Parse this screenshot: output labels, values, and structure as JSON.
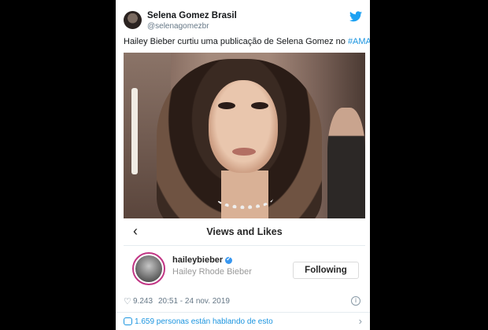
{
  "tweet": {
    "author_name": "Selena Gomez Brasil",
    "author_handle": "@selenagomezbr",
    "text_main": "Hailey Bieber curtiu uma publicação de Selena Gomez no ",
    "hashtag": "#AMAs",
    "text_end": "!",
    "likes": "9.243",
    "timestamp": "20:51 - 24 nov. 2019",
    "footer_text": "1.659 personas están hablando de esto"
  },
  "instagram": {
    "header_title": "Views and Likes",
    "username": "haileybieber",
    "full_name": "Hailey Rhode Bieber",
    "follow_label": "Following"
  },
  "colors": {
    "twitter_blue": "#1b95e0",
    "ig_border": "#c13584",
    "verified_blue": "#3897f0"
  },
  "icons": [
    "twitter-bird-icon",
    "chevron-left-icon",
    "verified-icon",
    "heart-icon",
    "info-icon",
    "speech-bubble-icon",
    "chevron-right-icon"
  ]
}
